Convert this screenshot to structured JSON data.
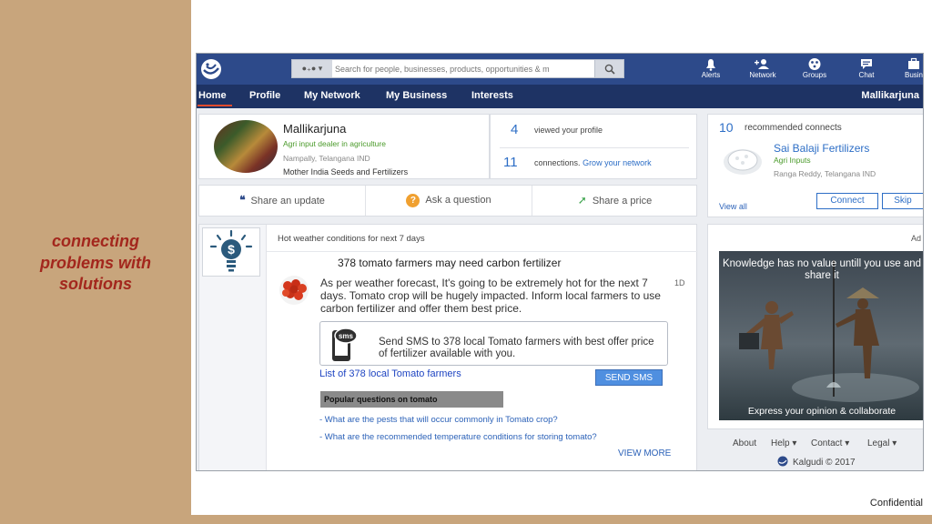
{
  "slide": {
    "caption_lines": [
      "connecting",
      "problems with",
      "solutions"
    ],
    "confidential": "Confidential"
  },
  "header": {
    "search_placeholder": "Search for people, businesses, products, opportunities & m",
    "icons": [
      {
        "label": "Alerts",
        "icon": "bell-icon"
      },
      {
        "label": "Network",
        "icon": "add-user-icon"
      },
      {
        "label": "Groups",
        "icon": "groups-icon"
      },
      {
        "label": "Chat",
        "icon": "chat-icon"
      },
      {
        "label": "Busin",
        "icon": "briefcase-icon"
      }
    ]
  },
  "nav": {
    "tabs": [
      "Home",
      "Profile",
      "My Network",
      "My Business",
      "Interests"
    ],
    "username": "Mallikarjuna"
  },
  "profile": {
    "name": "Mallikarjuna",
    "role": "Agri input dealer in agriculture",
    "location": "Nampally, Telangana IND",
    "company": "Mother India Seeds and Fertilizers"
  },
  "stats": {
    "views_count": "4",
    "views_label": "viewed your profile",
    "connections_count": "11",
    "connections_label": "connections.",
    "grow_link": "Grow your network"
  },
  "actions": {
    "share_update": "Share an update",
    "ask_question": "Ask a question",
    "share_price": "Share a price"
  },
  "post": {
    "header": "Hot weather conditions for next 7 days",
    "headline": "378 tomato farmers may need carbon fertilizer",
    "message": "As per weather forecast, It's going to be extremely hot for the next 7 days. Tomato crop will be hugely impacted. Inform local farmers to use carbon fertilizer and offer them best price.",
    "age": "1D",
    "sms_icon_label": "sms",
    "sms_text": "Send SMS to 378 local Tomato farmers with best offer price of fertilizer available with you.",
    "farmers_link": "List of 378 local Tomato farmers",
    "send_sms": "SEND SMS",
    "popular_title": "Popular questions on tomato",
    "questions": [
      "- What are the pests that will occur commonly in Tomato crop?",
      "- What are the recommended temperature conditions for storing tomato?"
    ],
    "view_more": "VIEW MORE"
  },
  "recommend": {
    "count": "10",
    "title": "recommended connects",
    "name": "Sai Balaji Fertilizers",
    "role": "Agri Inputs",
    "location": "Ranga Reddy, Telangana IND",
    "view_all": "View all",
    "connect": "Connect",
    "skip": "Skip"
  },
  "ad": {
    "label": "Ad",
    "caption_top": "Knowledge has no value untill you use and share it",
    "caption_bottom": "Express your opinion & collaborate"
  },
  "footer": {
    "about": "About",
    "help": "Help",
    "contact": "Contact",
    "legal": "Legal",
    "copyright": "Kalgudi © 2017"
  },
  "colors": {
    "topbar": "#2d4a8a",
    "navbar": "#1e3364",
    "accent": "#2d6ec6",
    "caption": "#a3271d",
    "slide_bg": "#c8a57c"
  }
}
